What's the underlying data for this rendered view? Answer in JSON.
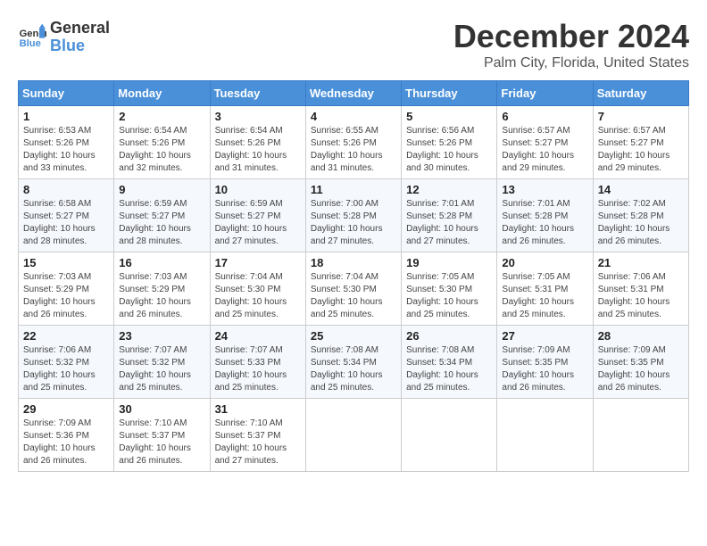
{
  "logo": {
    "line1": "General",
    "line2": "Blue"
  },
  "title": "December 2024",
  "subtitle": "Palm City, Florida, United States",
  "days_header": [
    "Sunday",
    "Monday",
    "Tuesday",
    "Wednesday",
    "Thursday",
    "Friday",
    "Saturday"
  ],
  "weeks": [
    [
      {
        "day": "1",
        "info": "Sunrise: 6:53 AM\nSunset: 5:26 PM\nDaylight: 10 hours\nand 33 minutes."
      },
      {
        "day": "2",
        "info": "Sunrise: 6:54 AM\nSunset: 5:26 PM\nDaylight: 10 hours\nand 32 minutes."
      },
      {
        "day": "3",
        "info": "Sunrise: 6:54 AM\nSunset: 5:26 PM\nDaylight: 10 hours\nand 31 minutes."
      },
      {
        "day": "4",
        "info": "Sunrise: 6:55 AM\nSunset: 5:26 PM\nDaylight: 10 hours\nand 31 minutes."
      },
      {
        "day": "5",
        "info": "Sunrise: 6:56 AM\nSunset: 5:26 PM\nDaylight: 10 hours\nand 30 minutes."
      },
      {
        "day": "6",
        "info": "Sunrise: 6:57 AM\nSunset: 5:27 PM\nDaylight: 10 hours\nand 29 minutes."
      },
      {
        "day": "7",
        "info": "Sunrise: 6:57 AM\nSunset: 5:27 PM\nDaylight: 10 hours\nand 29 minutes."
      }
    ],
    [
      {
        "day": "8",
        "info": "Sunrise: 6:58 AM\nSunset: 5:27 PM\nDaylight: 10 hours\nand 28 minutes."
      },
      {
        "day": "9",
        "info": "Sunrise: 6:59 AM\nSunset: 5:27 PM\nDaylight: 10 hours\nand 28 minutes."
      },
      {
        "day": "10",
        "info": "Sunrise: 6:59 AM\nSunset: 5:27 PM\nDaylight: 10 hours\nand 27 minutes."
      },
      {
        "day": "11",
        "info": "Sunrise: 7:00 AM\nSunset: 5:28 PM\nDaylight: 10 hours\nand 27 minutes."
      },
      {
        "day": "12",
        "info": "Sunrise: 7:01 AM\nSunset: 5:28 PM\nDaylight: 10 hours\nand 27 minutes."
      },
      {
        "day": "13",
        "info": "Sunrise: 7:01 AM\nSunset: 5:28 PM\nDaylight: 10 hours\nand 26 minutes."
      },
      {
        "day": "14",
        "info": "Sunrise: 7:02 AM\nSunset: 5:28 PM\nDaylight: 10 hours\nand 26 minutes."
      }
    ],
    [
      {
        "day": "15",
        "info": "Sunrise: 7:03 AM\nSunset: 5:29 PM\nDaylight: 10 hours\nand 26 minutes."
      },
      {
        "day": "16",
        "info": "Sunrise: 7:03 AM\nSunset: 5:29 PM\nDaylight: 10 hours\nand 26 minutes."
      },
      {
        "day": "17",
        "info": "Sunrise: 7:04 AM\nSunset: 5:30 PM\nDaylight: 10 hours\nand 25 minutes."
      },
      {
        "day": "18",
        "info": "Sunrise: 7:04 AM\nSunset: 5:30 PM\nDaylight: 10 hours\nand 25 minutes."
      },
      {
        "day": "19",
        "info": "Sunrise: 7:05 AM\nSunset: 5:30 PM\nDaylight: 10 hours\nand 25 minutes."
      },
      {
        "day": "20",
        "info": "Sunrise: 7:05 AM\nSunset: 5:31 PM\nDaylight: 10 hours\nand 25 minutes."
      },
      {
        "day": "21",
        "info": "Sunrise: 7:06 AM\nSunset: 5:31 PM\nDaylight: 10 hours\nand 25 minutes."
      }
    ],
    [
      {
        "day": "22",
        "info": "Sunrise: 7:06 AM\nSunset: 5:32 PM\nDaylight: 10 hours\nand 25 minutes."
      },
      {
        "day": "23",
        "info": "Sunrise: 7:07 AM\nSunset: 5:32 PM\nDaylight: 10 hours\nand 25 minutes."
      },
      {
        "day": "24",
        "info": "Sunrise: 7:07 AM\nSunset: 5:33 PM\nDaylight: 10 hours\nand 25 minutes."
      },
      {
        "day": "25",
        "info": "Sunrise: 7:08 AM\nSunset: 5:34 PM\nDaylight: 10 hours\nand 25 minutes."
      },
      {
        "day": "26",
        "info": "Sunrise: 7:08 AM\nSunset: 5:34 PM\nDaylight: 10 hours\nand 25 minutes."
      },
      {
        "day": "27",
        "info": "Sunrise: 7:09 AM\nSunset: 5:35 PM\nDaylight: 10 hours\nand 26 minutes."
      },
      {
        "day": "28",
        "info": "Sunrise: 7:09 AM\nSunset: 5:35 PM\nDaylight: 10 hours\nand 26 minutes."
      }
    ],
    [
      {
        "day": "29",
        "info": "Sunrise: 7:09 AM\nSunset: 5:36 PM\nDaylight: 10 hours\nand 26 minutes."
      },
      {
        "day": "30",
        "info": "Sunrise: 7:10 AM\nSunset: 5:37 PM\nDaylight: 10 hours\nand 26 minutes."
      },
      {
        "day": "31",
        "info": "Sunrise: 7:10 AM\nSunset: 5:37 PM\nDaylight: 10 hours\nand 27 minutes."
      },
      {
        "day": "",
        "info": ""
      },
      {
        "day": "",
        "info": ""
      },
      {
        "day": "",
        "info": ""
      },
      {
        "day": "",
        "info": ""
      }
    ]
  ]
}
